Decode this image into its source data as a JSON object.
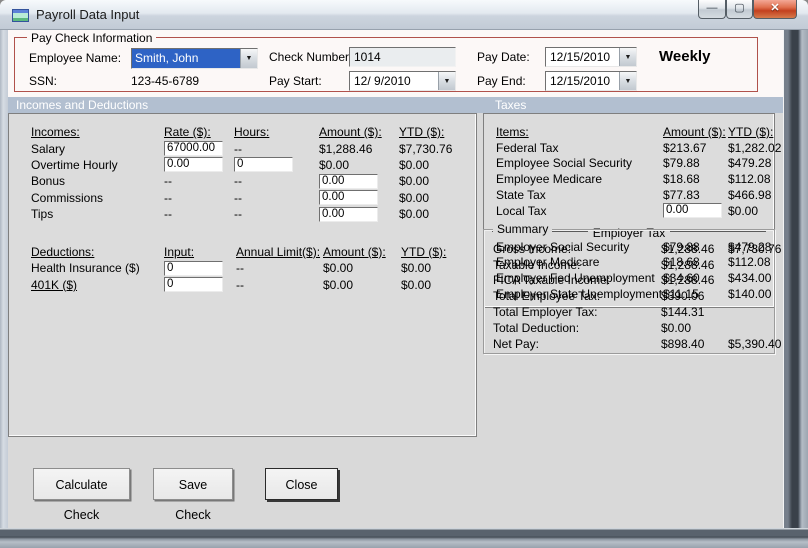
{
  "window": {
    "title": "Payroll Data Input",
    "controls": {
      "minimize": "—",
      "maximize": "▢",
      "close": "✕"
    }
  },
  "paycheck": {
    "group_title": "Pay Check Information",
    "employee_name_label": "Employee Name:",
    "employee_name_value": "Smith, John",
    "ssn_label": "SSN:",
    "ssn_value": "123-45-6789",
    "check_number_label": "Check Number:",
    "check_number_value": "1014",
    "pay_start_label": "Pay Start:",
    "pay_start_value": "12/ 9/2010",
    "pay_date_label": "Pay Date:",
    "pay_date_value": "12/15/2010",
    "pay_end_label": "Pay End:",
    "pay_end_value": "12/15/2010",
    "frequency": "Weekly",
    "dropdown_arrow": "▼"
  },
  "sections": {
    "incomes_header": "Incomes and Deductions",
    "taxes_header": "Taxes"
  },
  "incomes": {
    "headers": {
      "item": "Incomes:",
      "rate": "Rate ($):",
      "hours": "Hours:",
      "amount": "Amount ($):",
      "ytd": "YTD ($):"
    },
    "rows": [
      {
        "label": "Salary",
        "rate": "67000.00",
        "hours": "--",
        "amount": "$1,288.46",
        "ytd": "$7,730.76"
      },
      {
        "label": "Overtime Hourly",
        "rate": "0.00",
        "hours": "0",
        "amount": "$0.00",
        "ytd": "$0.00"
      },
      {
        "label": "Bonus",
        "rate": "--",
        "hours": "--",
        "amount": "0.00",
        "ytd": "$0.00"
      },
      {
        "label": "Commissions",
        "rate": "--",
        "hours": "--",
        "amount": "0.00",
        "ytd": "$0.00"
      },
      {
        "label": "Tips",
        "rate": "--",
        "hours": "--",
        "amount": "0.00",
        "ytd": "$0.00"
      }
    ]
  },
  "deductions": {
    "headers": {
      "item": "Deductions:",
      "input": "Input:",
      "annual_limit": "Annual Limit($):",
      "amount": "Amount ($):",
      "ytd": "YTD ($):"
    },
    "rows": [
      {
        "label": "Health Insurance  ($)",
        "input": "0",
        "annual_limit": "--",
        "amount": "$0.00",
        "ytd": "$0.00"
      },
      {
        "label": "401K  ($)",
        "input": "0",
        "annual_limit": "--",
        "amount": "$0.00",
        "ytd": "$0.00"
      }
    ]
  },
  "taxes": {
    "headers": {
      "item": "Items:",
      "amount": "Amount ($):",
      "ytd": "YTD ($):"
    },
    "rows": [
      {
        "label": "Federal Tax",
        "amount": "$213.67",
        "ytd": "$1,282.02"
      },
      {
        "label": "Employee Social Security",
        "amount": "$79.88",
        "ytd": "$479.28"
      },
      {
        "label": "Employee Medicare",
        "amount": "$18.68",
        "ytd": "$112.08"
      },
      {
        "label": "State Tax",
        "amount": "$77.83",
        "ytd": "$466.98"
      },
      {
        "label": "Local Tax",
        "amount": "0.00",
        "ytd": "$0.00"
      }
    ],
    "employer_group_title": "Employer Tax",
    "employer_rows": [
      {
        "label": "Employer Social Security",
        "amount": "$79.88",
        "ytd": "$479.28"
      },
      {
        "label": "Employer Medicare",
        "amount": "$18.68",
        "ytd": "$112.08"
      },
      {
        "label": "Employer Fed Unemployment",
        "amount": "$34.60",
        "ytd": "$434.00"
      },
      {
        "label": "Employer State Unemployment",
        "amount": "$11.15",
        "ytd": "$140.00"
      }
    ]
  },
  "summary": {
    "group_title": "Summary",
    "rows": [
      {
        "label": "Gross Income:",
        "amount": "$1,288.46",
        "ytd": "$7,730.76"
      },
      {
        "label": "Taxable Income:",
        "amount": "$1,288.46",
        "ytd": ""
      },
      {
        "label": "FICA Taxable Income:",
        "amount": "$1,288.46",
        "ytd": ""
      },
      {
        "label": "Total Employee Tax:",
        "amount": "$390.06",
        "ytd": ""
      },
      {
        "label": "Total Employer Tax:",
        "amount": "$144.31",
        "ytd": ""
      },
      {
        "label": "Total Deduction:",
        "amount": "$0.00",
        "ytd": ""
      },
      {
        "label": "Net Pay:",
        "amount": "$898.40",
        "ytd": "$5,390.40"
      }
    ]
  },
  "buttons": {
    "calculate": "Calculate Check",
    "save": "Save Check",
    "close": "Close"
  },
  "colors": {
    "group_border_red": "#b0514b",
    "section_band": "#b2bfd0",
    "selection_blue": "#2e63c5",
    "close_button_red": "#c3401f",
    "panel_gray": "#dcdcdc"
  }
}
